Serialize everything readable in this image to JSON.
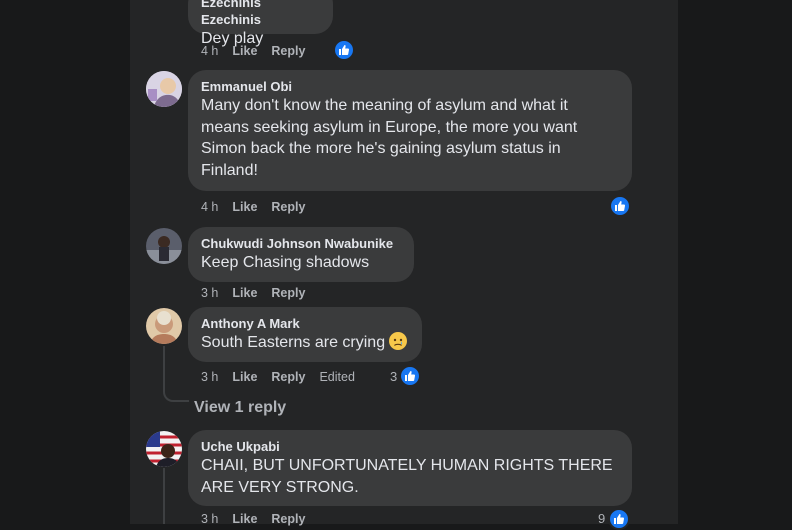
{
  "comments": [
    {
      "author": "Ezechinis Ezechinis",
      "text": "Dey play",
      "time": "4 h",
      "like": "Like",
      "reply": "Reply"
    },
    {
      "author": "Emmanuel Obi",
      "text_lines": [
        "Many don't know the meaning of asylum and what it",
        "means seeking asylum in Europe, the more you want",
        "Simon back the more he's gaining asylum status in",
        "Finland!"
      ],
      "time": "4 h",
      "like": "Like",
      "reply": "Reply"
    },
    {
      "author": "Chukwudi Johnson Nwabunike",
      "text": "Keep Chasing shadows",
      "time": "3 h",
      "like": "Like",
      "reply": "Reply"
    },
    {
      "author": "Anthony A Mark",
      "text": "South Easterns are crying",
      "emoji": "crying-face-icon",
      "time": "3 h",
      "like": "Like",
      "reply": "Reply",
      "edited": "Edited",
      "reactions": "3",
      "view_replies": "View 1 reply"
    },
    {
      "author": "Uche Ukpabi",
      "text_lines": [
        "CHAII, BUT UNFORTUNATELY HUMAN RIGHTS THERE",
        "ARE VERY STRONG."
      ],
      "time": "3 h",
      "like": "Like",
      "reply": "Reply",
      "reactions": "9"
    }
  ],
  "colors": {
    "background": "#18191a",
    "panel": "#242526",
    "bubble": "#3a3b3c",
    "text": "#e4e6eb",
    "secondary": "#b0b3b8",
    "like_blue": "#1877f2"
  }
}
